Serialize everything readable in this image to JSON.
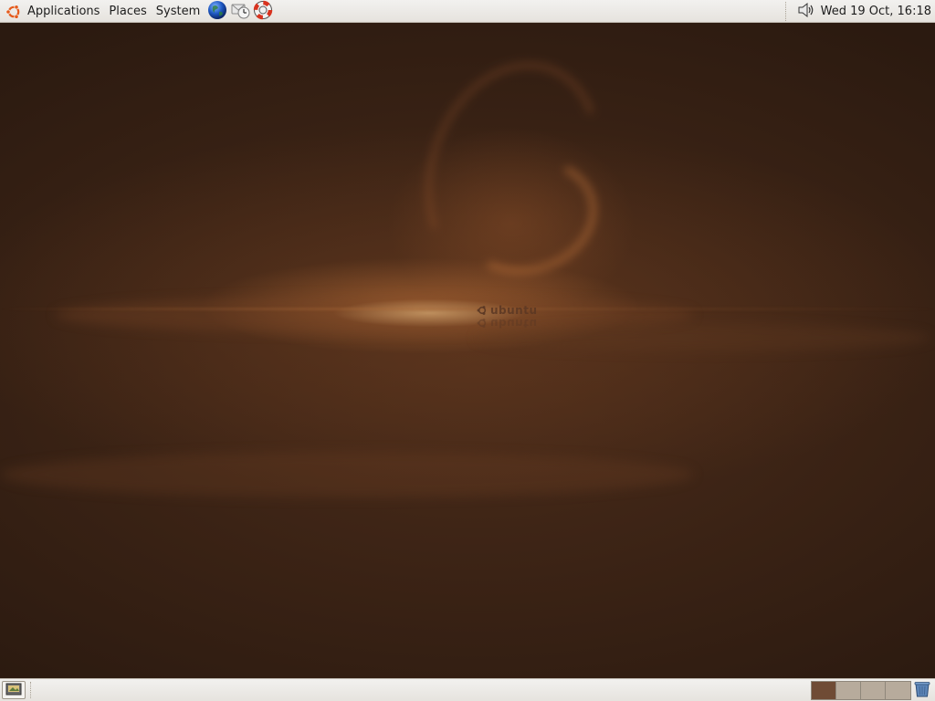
{
  "top_panel": {
    "menus": {
      "applications": "Applications",
      "places": "Places",
      "system": "System"
    },
    "launchers": [
      "web-browser-icon",
      "mail-client-icon",
      "help-icon"
    ],
    "clock": "Wed 19 Oct, 16:18",
    "volume_icon": "speaker-volume-icon"
  },
  "desktop": {
    "wallpaper_logo_text": "ubuntu"
  },
  "bottom_panel": {
    "show_desktop_icon": "show-desktop-icon",
    "workspaces": [
      {
        "active": true
      },
      {
        "active": false
      },
      {
        "active": false
      },
      {
        "active": false
      }
    ],
    "trash_icon": "trash-icon"
  },
  "colors": {
    "panel_bg": "#ebe8e4",
    "ubuntu_orange": "#e55a1b",
    "workspace_active": "#6f4b35",
    "workspace_inactive": "#b7ab9c"
  }
}
